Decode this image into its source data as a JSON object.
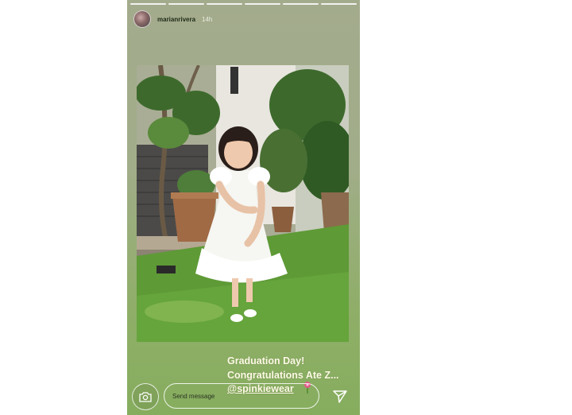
{
  "story": {
    "username": "marianrivera",
    "time": "14h",
    "progress_segments": 6
  },
  "caption": {
    "line1": "Graduation Day!",
    "line2": "Congratulations Ate Z...",
    "mention": "@spinkiewear"
  },
  "reply": {
    "placeholder": "Send message"
  },
  "icons": {
    "camera": "camera-icon",
    "send": "send-icon",
    "emoji": "flower-emoji-icon"
  },
  "colors": {
    "background": "#a1ad89",
    "caption": "#fffbe6"
  }
}
